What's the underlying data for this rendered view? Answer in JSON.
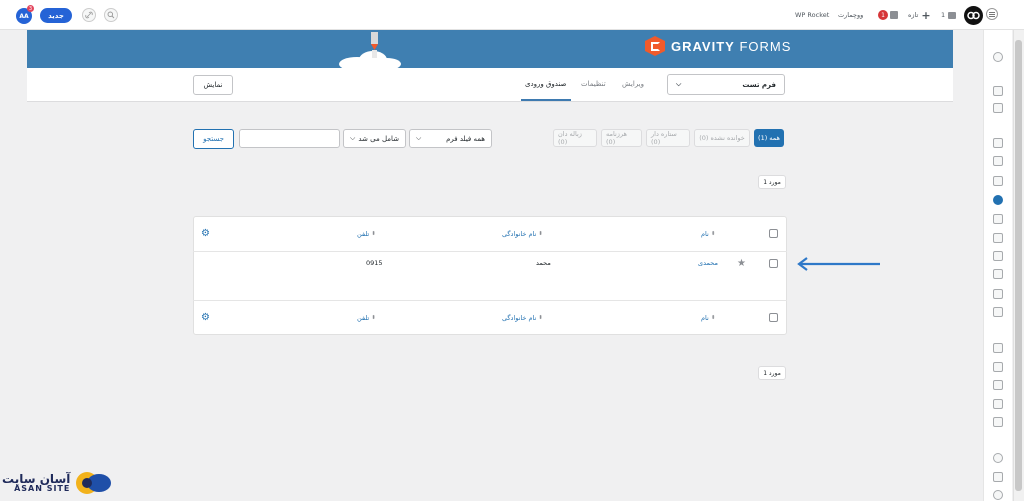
{
  "topbar": {
    "avatar": "AA",
    "avatar_badge": "3",
    "new_button": "جدید",
    "wp_rocket": "WP Rocket",
    "woocommerce": "ووچمارت",
    "updates_count": "1",
    "new_item": "تازه",
    "comments_count": "1"
  },
  "banner": {
    "brand_bold": "GRAVITY",
    "brand_light": " FORMS"
  },
  "toolbar": {
    "form_select": "فرم تست",
    "tabs": [
      "ویرایش",
      "تنظیمات",
      "صندوق ورودی"
    ],
    "view_button": "نمایش"
  },
  "filters": {
    "links": [
      "همه (1)",
      "خوانده نشده (0)",
      "ستاره دار (0)",
      "هرزنامه (0)",
      "زباله دان (0)"
    ],
    "field_select": "همه فیلد فرم",
    "operator_select": "شامل می شد",
    "search_placeholder": "",
    "search_button": "جستجو"
  },
  "pagination": {
    "top_count": "1 مورد",
    "bottom_count": "1 مورد"
  },
  "table": {
    "columns": [
      "نام",
      "نام خانوادگی",
      "تلفن"
    ],
    "rows": [
      {
        "first_name": "محمدی",
        "last_name": "محمد",
        "phone": "0915"
      }
    ]
  },
  "watermark": {
    "fa": "آسان سایت",
    "en": "ASAN SITE"
  },
  "colors": {
    "accent": "#2271b1",
    "banner": "#3f7fb1",
    "gf_orange": "#f15a2b",
    "arrow": "#2e78c8"
  }
}
